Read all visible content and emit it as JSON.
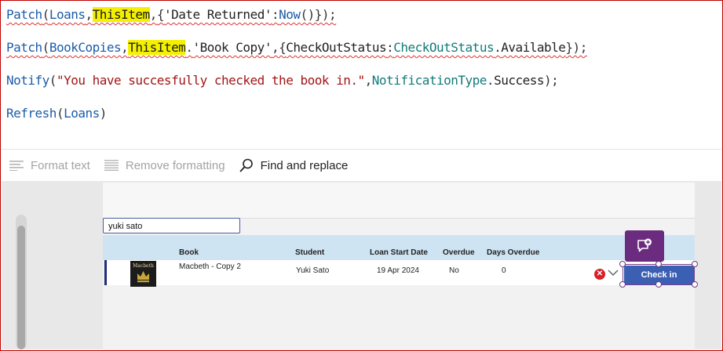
{
  "formula": {
    "line1": {
      "patch_fn": "Patch",
      "open": "(",
      "loans": "Loans",
      "comma1": ",",
      "this_item": "ThisItem",
      "comma2": ",",
      "brace_open": "{",
      "field": "'Date Returned'",
      "colon": ":",
      "now_fn": "Now",
      "tail": "()});"
    },
    "line2": {
      "patch_fn": "Patch",
      "open": "(",
      "book_copies": "BookCopies",
      "comma1": ",",
      "this_item": "ThisItem",
      "dot": ".",
      "field": "'Book Copy'",
      "comma_brace": ",{",
      "status_field": "CheckOutStatus",
      "colon": ":",
      "status_enum": "CheckOutStatus",
      "dot2": ".",
      "available": "Available",
      "tail": "});"
    },
    "line3": {
      "notify_fn": "Notify",
      "open": "(",
      "message": "\"You have succesfully checked the book in.\"",
      "comma": ",",
      "notif_type": "NotificationType",
      "dot": ".",
      "success": "Success",
      "tail": ");"
    },
    "line4": {
      "refresh_fn": "Refresh",
      "open": "(",
      "loans": "Loans",
      "close": ")"
    }
  },
  "toolbar": {
    "format_text": "Format text",
    "remove_formatting": "Remove formatting",
    "find_replace": "Find and replace"
  },
  "app": {
    "search_value": "yuki sato",
    "columns": [
      "Book",
      "Student",
      "Loan Start Date",
      "Overdue",
      "Days Overdue"
    ],
    "row": {
      "book": "Macbeth - Copy 2",
      "cover_text": "Macbeth",
      "student": "Yuki Sato",
      "loan_start": "19 Apr 2024",
      "overdue": "No",
      "days_overdue": "0"
    },
    "checkin_label": "Check in"
  },
  "colors": {
    "highlight": "#f4f000",
    "function": "#1b5ca8",
    "string": "#a31515",
    "control": "#117a7a",
    "checkin_button": "#3b5fb3",
    "comment_button": "#6b2c80",
    "delete_icon": "#d81f2a"
  },
  "icons": [
    "format-text-icon",
    "remove-formatting-icon",
    "search-icon",
    "delete-icon",
    "chevron-down-icon",
    "add-comment-icon"
  ]
}
